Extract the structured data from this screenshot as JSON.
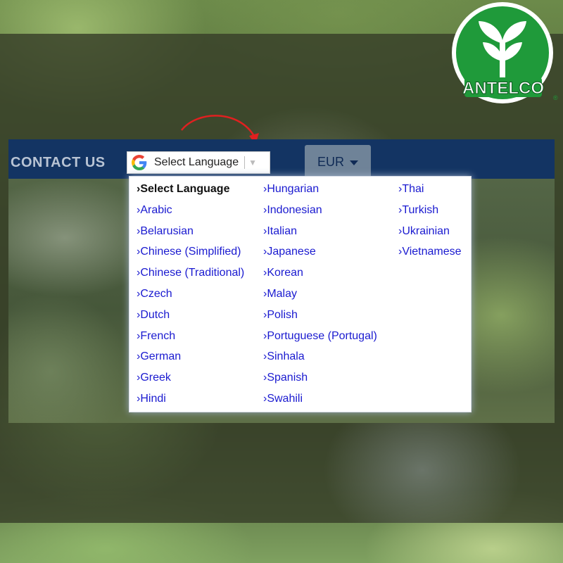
{
  "nav": {
    "contact_label": "CONTACT US",
    "currency_label": "EUR",
    "language_select_label": "Select Language"
  },
  "brand": {
    "logo_text": "ANTELCO",
    "registered_mark": "®",
    "green": "#1f9a3a"
  },
  "accent_colors": {
    "navbar": "#133463",
    "link": "#1a1ad0",
    "annotation_arrow": "#e02020"
  },
  "language_menu": {
    "columns": [
      [
        "›Select Language",
        "›Arabic",
        "›Belarusian",
        "›Chinese (Simplified)",
        "›Chinese (Traditional)",
        "›Czech",
        "›Dutch",
        "›French",
        "›German",
        "›Greek",
        "›Hindi"
      ],
      [
        "›Hungarian",
        "›Indonesian",
        "›Italian",
        "›Japanese",
        "›Korean",
        "›Malay",
        "›Polish",
        "›Portuguese (Portugal)",
        "›Sinhala",
        "›Spanish",
        "›Swahili"
      ],
      [
        "›Thai",
        "›Turkish",
        "›Ukrainian",
        "›Vietnamese"
      ]
    ],
    "selected": "›Select Language"
  },
  "icons": {
    "google": "google-g-icon",
    "dropdown": "triangle-down-icon",
    "currency_caret": "caret-down-icon",
    "annotation": "curved-arrow-icon"
  }
}
